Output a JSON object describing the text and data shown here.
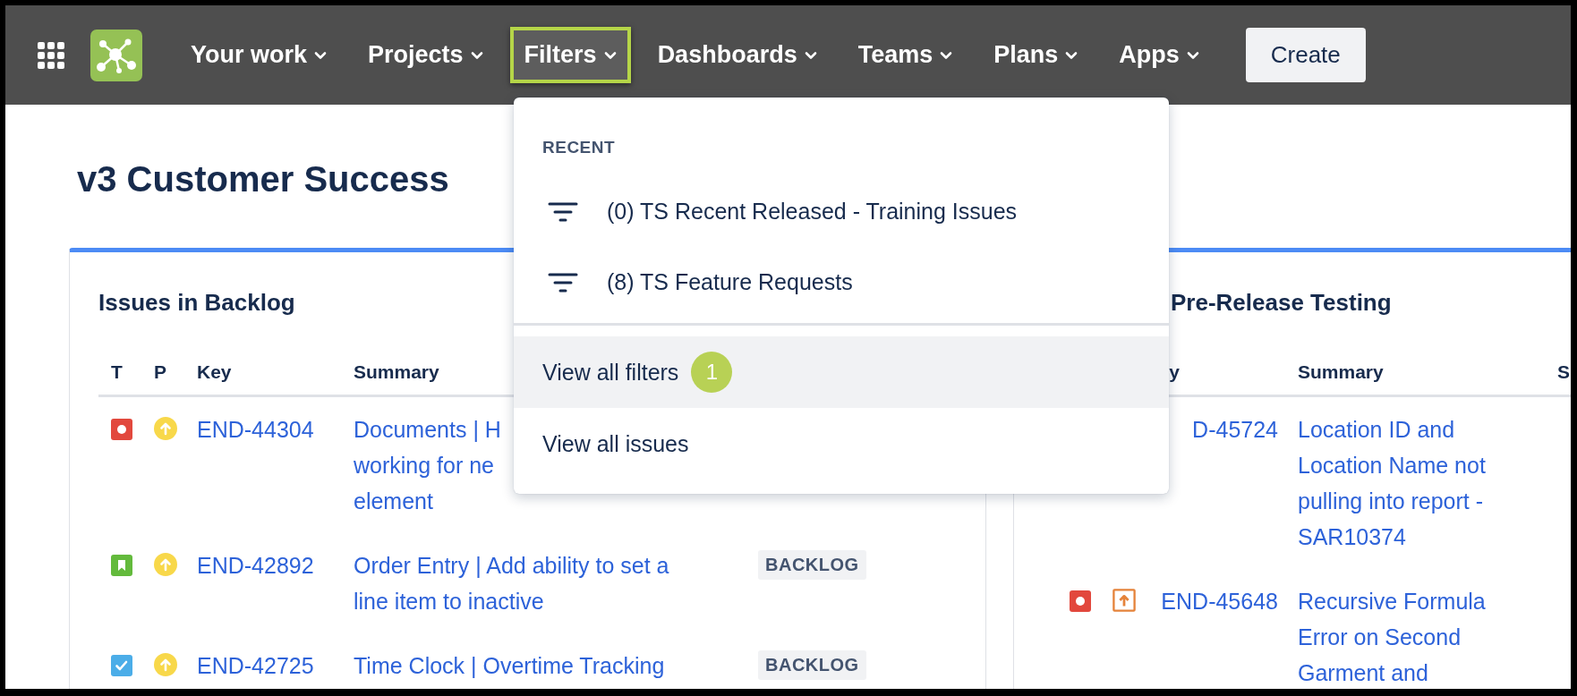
{
  "nav": {
    "items": [
      {
        "label": "Your work",
        "selected": false
      },
      {
        "label": "Projects",
        "selected": false
      },
      {
        "label": "Filters",
        "selected": true
      },
      {
        "label": "Dashboards",
        "selected": false
      },
      {
        "label": "Teams",
        "selected": false
      },
      {
        "label": "Plans",
        "selected": false
      },
      {
        "label": "Apps",
        "selected": false
      }
    ],
    "create_button": "Create"
  },
  "page_title": "v3 Customer Success",
  "left_gadget": {
    "title": "Issues in Backlog",
    "columns": [
      "T",
      "P",
      "Key",
      "Summary"
    ],
    "rows": [
      {
        "type": {
          "kind": "bug"
        },
        "priority": {
          "kind": "medium"
        },
        "key": "END-44304",
        "summary": [
          "Documents | H",
          "working for ne",
          "element"
        ]
      },
      {
        "type": {
          "kind": "story"
        },
        "priority": {
          "kind": "medium"
        },
        "key": "END-42892",
        "summary": [
          "Order Entry | Add ability to set a",
          "line item to inactive"
        ],
        "status": "BACKLOG"
      },
      {
        "type": {
          "kind": "task"
        },
        "priority": {
          "kind": "medium"
        },
        "key": "END-42725",
        "summary": [
          "Time Clock | Overtime Tracking"
        ],
        "status": "BACKLOG"
      }
    ]
  },
  "right_gadget": {
    "title": "Pre-Release Testing",
    "columns": [
      "y",
      "Summary",
      "S"
    ],
    "rows": [
      {
        "key": "D-45724",
        "summary": [
          "Location ID and",
          "Location Name not",
          "pulling into report -",
          "SAR10374"
        ]
      },
      {
        "type": {
          "kind": "bug"
        },
        "priority": {
          "kind": "high"
        },
        "key": "END-45648",
        "summary": [
          "Recursive Formula",
          "Error on Second",
          "Garment and"
        ]
      }
    ]
  },
  "filters_menu": {
    "section": "RECENT",
    "recent": [
      "(0) TS Recent Released - Training Issues",
      "(8) TS Feature Requests"
    ],
    "links": [
      {
        "label": "View all filters",
        "selected": true,
        "callout": "1"
      },
      {
        "label": "View all issues",
        "selected": false
      }
    ]
  }
}
